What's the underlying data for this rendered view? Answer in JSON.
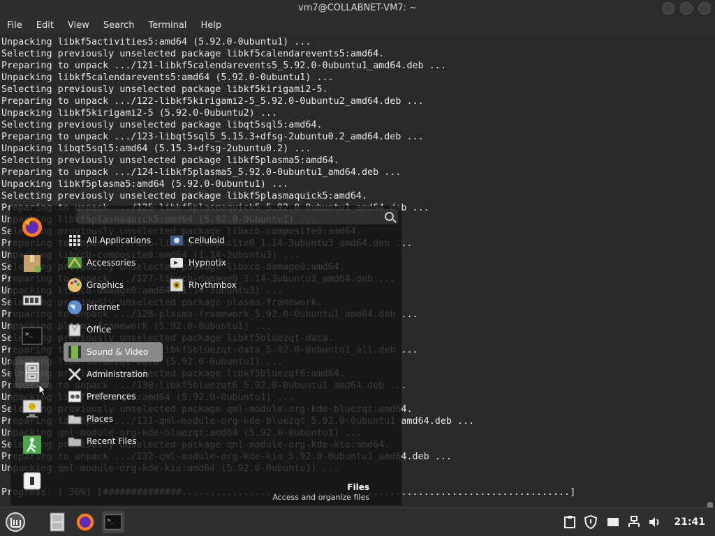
{
  "window": {
    "title": "vm7@COLLABNET-VM7: ~"
  },
  "menubar": {
    "items": [
      "File",
      "Edit",
      "View",
      "Search",
      "Terminal",
      "Help"
    ]
  },
  "terminal": {
    "lines": [
      "Unpacking libkf5activities5:amd64 (5.92.0-0ubuntu1) ...",
      "Selecting previously unselected package libkf5calendarevents5:amd64.",
      "Preparing to unpack .../121-libkf5calendarevents5_5.92.0-0ubuntu1_amd64.deb ...",
      "Unpacking libkf5calendarevents5:amd64 (5.92.0-0ubuntu1) ...",
      "Selecting previously unselected package libkf5kirigami2-5.",
      "Preparing to unpack .../122-libkf5kirigami2-5_5.92.0-0ubuntu2_amd64.deb ...",
      "Unpacking libkf5kirigami2-5 (5.92.0-0ubuntu2) ...",
      "Selecting previously unselected package libqt5sql5:amd64.",
      "Preparing to unpack .../123-libqt5sql5_5.15.3+dfsg-2ubuntu0.2_amd64.deb ...",
      "Unpacking libqt5sql5:amd64 (5.15.3+dfsg-2ubuntu0.2) ...",
      "Selecting previously unselected package libkf5plasma5:amd64.",
      "Preparing to unpack .../124-libkf5plasma5_5.92.0-0ubuntu1_amd64.deb ...",
      "Unpacking libkf5plasma5:amd64 (5.92.0-0ubuntu1) ...",
      "Selecting previously unselected package libkf5plasmaquick5:amd64.",
      "Preparing to unpack .../125-libkf5plasmaquick5_5.92.0-0ubuntu1_amd64.deb ...",
      "Unpacking libkf5plasmaquick5:amd64 (5.92.0-0ubuntu1) ...",
      "Selecting previously unselected package libxcb-composite0:amd64.",
      "Preparing to unpack .../126-libxcb-composite0_1.14-3ubuntu3_amd64.deb ...",
      "Unpacking libxcb-composite0:amd64 (1.14-3ubuntu3) ...",
      "Selecting previously unselected package libxcb-damage0:amd64.",
      "Preparing to unpack .../127-libxcb-damage0_1.14-3ubuntu3_amd64.deb ...",
      "Unpacking libxcb-damage0:amd64 (1.14-3ubuntu3) ...",
      "Selecting previously unselected package plasma-framework.",
      "Preparing to unpack .../128-plasma-framework_5.92.0-0ubuntu1_amd64.deb ...",
      "Unpacking plasma-framework (5.92.0-0ubuntu1) ...",
      "Selecting previously unselected package libkf5bluezqt-data.",
      "Preparing to unpack .../129-libkf5bluezqt-data_5.92.0-0ubuntu1_all.deb ...",
      "Unpacking libkf5bluezqt-data (5.92.0-0ubuntu1) ...",
      "Selecting previously unselected package libkf5bluezqt6:amd64.",
      "Preparing to unpack .../130-libkf5bluezqt6_5.92.0-0ubuntu1_amd64.deb ...",
      "Unpacking libkf5bluezqt6:amd64 (5.92.0-0ubuntu1) ...",
      "Selecting previously unselected package qml-module-org-kde-bluezqt:amd64.",
      "Preparing to unpack .../131-qml-module-org-kde-bluezqt_5.92.0-0ubuntu1_amd64.deb ...",
      "Unpacking qml-module-org-kde-bluezqt:amd64 (5.92.0-0ubuntu1) ...",
      "Selecting previously unselected package qml-module-org-kde-kio:amd64.",
      "Preparing to unpack .../132-qml-module-org-kde-kio_5.92.0-0ubuntu1_amd64.deb ...",
      "Unpacking qml-module-org-kde-kio:amd64 (5.92.0-0ubuntu1) ...",
      "",
      "Progress: [ 36%] [##############.....................................................................]"
    ]
  },
  "appmenu": {
    "search": {
      "value": "",
      "placeholder": ""
    },
    "categories": [
      "All Applications",
      "Accessories",
      "Graphics",
      "Internet",
      "Office",
      "Sound & Video",
      "Administration",
      "Preferences",
      "Places",
      "Recent Files"
    ],
    "selected_category": "Sound & Video",
    "apps": [
      "Celluloid",
      "Hypnotix",
      "Rhythmbox"
    ],
    "tooltip": {
      "title": "Files",
      "description": "Access and organize files"
    }
  },
  "panel": {
    "clock": "21:41"
  },
  "colors": {
    "terminal_bg": "#2a2a2a",
    "panel_bg": "#2f2f2f",
    "accent_green": "#7ab648"
  }
}
